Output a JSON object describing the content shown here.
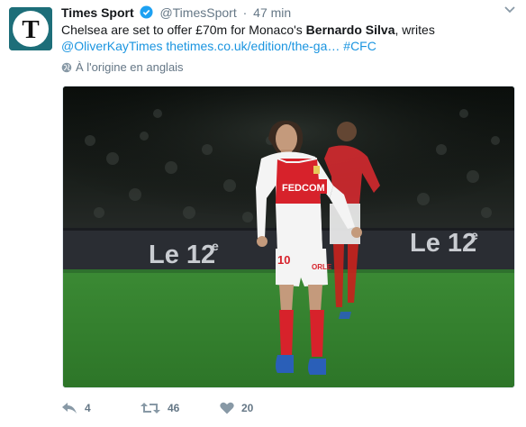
{
  "tweet": {
    "author_name": "Times Sport",
    "author_handle": "@TimesSport",
    "separator": "·",
    "time": "47 min",
    "avatar_letter": "T",
    "text_before": "Chelsea are set to offer £70m for Monaco's ",
    "text_bold": "Bernardo Silva",
    "text_after": ", writes",
    "link_handle": "@OliverKayTimes",
    "link_url": "thetimes.co.uk/edition/the-ga…",
    "hashtag": "#CFC",
    "translate_label": "À l'origine en anglais"
  },
  "media": {
    "board_text_left": "Le 12",
    "board_sup_left": "e",
    "board_text_right": "Le 12",
    "board_sup_right": "e",
    "shirt_sponsor": "FEDCOM",
    "shirt_number": "10",
    "shorts_text": "ORLE",
    "description_colors": {
      "pitch": "#2f7d2a",
      "shirt_red": "#d7222b",
      "boards": "#2a2d33"
    }
  },
  "actions": {
    "reply_count": "4",
    "retweet_count": "46",
    "like_count": "20"
  },
  "colors": {
    "link": "#1b95e0",
    "secondary_text": "#657786",
    "verified": "#1da1f2",
    "avatar_bg": "#1d6e79"
  }
}
